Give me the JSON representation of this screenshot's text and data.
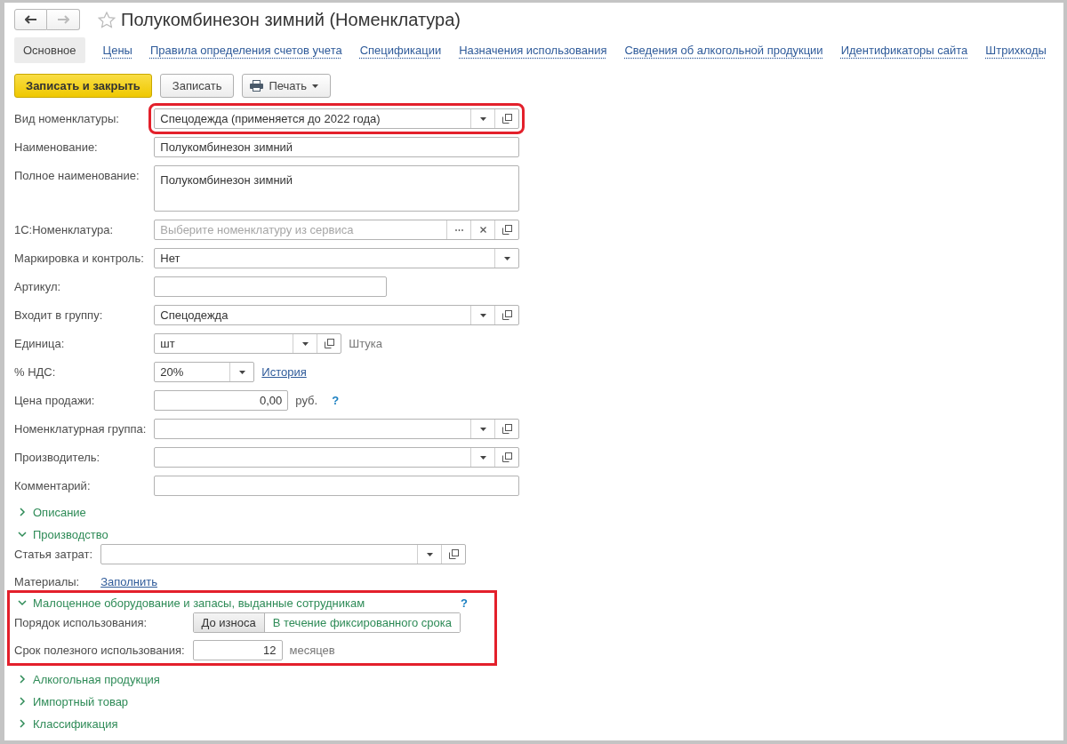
{
  "window": {
    "title": "Полукомбинезон зимний (Номенклатура)"
  },
  "nav": {
    "back": {
      "disabled": false
    },
    "forward": {
      "disabled": true
    }
  },
  "tabs": [
    {
      "label": "Основное",
      "selected": true
    },
    {
      "label": "Цены",
      "selected": false
    },
    {
      "label": "Правила определения счетов учета",
      "selected": false
    },
    {
      "label": "Спецификации",
      "selected": false
    },
    {
      "label": "Назначения использования",
      "selected": false
    },
    {
      "label": "Сведения об алкогольной продукции",
      "selected": false
    },
    {
      "label": "Идентификаторы сайта",
      "selected": false
    },
    {
      "label": "Штрихкоды",
      "selected": false
    }
  ],
  "toolbar": [
    {
      "label": "Записать и закрыть",
      "kind": "primary"
    },
    {
      "label": "Записать",
      "kind": "plain"
    },
    {
      "label": "Печать",
      "kind": "print"
    }
  ],
  "fields": [
    {
      "label": "Вид номенклатуры:",
      "kind": "combo",
      "value": "Спецодежда (применяется до 2022 года)",
      "highlighted": true
    },
    {
      "label": "Наименование:",
      "kind": "text",
      "value": "Полукомбинезон зимний"
    },
    {
      "label": "Полное наименование:",
      "kind": "textarea",
      "value": "Полукомбинезон зимний"
    },
    {
      "label": "1С:Номенклатура:",
      "kind": "picker",
      "placeholder": "Выберите номенклатуру из сервиса"
    },
    {
      "label": "Маркировка и контроль:",
      "kind": "select",
      "value": "Нет"
    },
    {
      "label": "Артикул:",
      "kind": "short"
    },
    {
      "label": "Входит в группу:",
      "kind": "combo",
      "value": "Спецодежда"
    },
    {
      "label": "Единица:",
      "kind": "unit",
      "value": "шт",
      "note": "Штука"
    },
    {
      "label": "% НДС:",
      "kind": "vat",
      "value": "20%",
      "link": "История"
    },
    {
      "label": "Цена продажи:",
      "kind": "price",
      "value": "0,00",
      "currency": "руб.",
      "help": "?"
    },
    {
      "label": "Номенклатурная группа:",
      "kind": "combo"
    },
    {
      "label": "Производитель:",
      "kind": "combo"
    },
    {
      "label": "Комментарий:",
      "kind": "text"
    }
  ],
  "sections": [
    {
      "title": "Описание",
      "expanded": false
    },
    {
      "title": "Производство",
      "expanded": true,
      "rows": [
        {
          "label": "Статья затрат:",
          "kind": "combo"
        },
        {
          "label": "Материалы:",
          "kind": "link",
          "link": "Заполнить"
        }
      ]
    },
    {
      "title": "Малоценное оборудование и запасы, выданные сотрудникам",
      "expanded": true,
      "highlighted": true,
      "help": "?",
      "rows": [
        {
          "label": "Порядок использования:",
          "kind": "segmented",
          "options": [
            {
              "label": "До износа",
              "selected": true
            },
            {
              "label": "В течение фиксированного срока",
              "selected": false
            }
          ]
        },
        {
          "label": "Срок полезного использования:",
          "kind": "number",
          "value": "12",
          "unit": "месяцев"
        }
      ]
    },
    {
      "title": "Алкогольная продукция",
      "expanded": false
    },
    {
      "title": "Импортный товар",
      "expanded": false
    },
    {
      "title": "Классификация",
      "expanded": false
    }
  ]
}
